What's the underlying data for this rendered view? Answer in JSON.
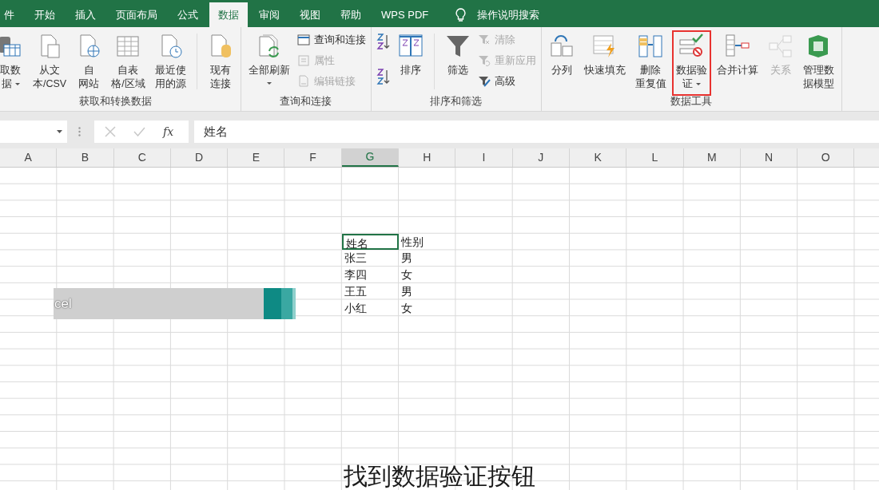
{
  "ribbon_tabs": [
    {
      "label": "件",
      "selected": false
    },
    {
      "label": "开始",
      "selected": false
    },
    {
      "label": "插入",
      "selected": false
    },
    {
      "label": "页面布局",
      "selected": false
    },
    {
      "label": "公式",
      "selected": false
    },
    {
      "label": "数据",
      "selected": true
    },
    {
      "label": "审阅",
      "selected": false
    },
    {
      "label": "视图",
      "selected": false
    },
    {
      "label": "帮助",
      "selected": false
    },
    {
      "label": "WPS PDF",
      "selected": false
    }
  ],
  "tell_me": "操作说明搜索",
  "ribbon_groups": [
    {
      "label": "获取和转换数据",
      "items": [
        {
          "kind": "large",
          "lines": [
            "取数",
            "据"
          ],
          "dropdown": true,
          "disabled": false,
          "highlighted": false
        },
        {
          "kind": "large",
          "lines": [
            "从文",
            "本/CSV"
          ],
          "dropdown": false,
          "disabled": false,
          "highlighted": false
        },
        {
          "kind": "large",
          "lines": [
            "自",
            "网站"
          ],
          "dropdown": false,
          "disabled": false,
          "highlighted": false
        },
        {
          "kind": "large",
          "lines": [
            "自表",
            "格/区域"
          ],
          "dropdown": false,
          "disabled": false,
          "highlighted": false
        },
        {
          "kind": "large",
          "lines": [
            "最近使",
            "用的源"
          ],
          "dropdown": false,
          "disabled": false,
          "highlighted": false
        },
        {
          "kind": "separator"
        },
        {
          "kind": "large",
          "lines": [
            "现有",
            "连接"
          ],
          "dropdown": false,
          "disabled": false,
          "highlighted": false
        }
      ]
    },
    {
      "label": "查询和连接",
      "items": [
        {
          "kind": "large",
          "lines": [
            "全部刷新"
          ],
          "dropdown": true,
          "disabled": false,
          "highlighted": false
        },
        {
          "kind": "stack",
          "items": [
            {
              "label": "查询和连接",
              "disabled": false
            },
            {
              "label": "属性",
              "disabled": true
            },
            {
              "label": "编辑链接",
              "disabled": true
            }
          ]
        }
      ]
    },
    {
      "label": "排序和筛选",
      "items": [
        {
          "kind": "stack",
          "items": [
            {
              "disabled": false
            },
            {
              "disabled": false
            }
          ]
        },
        {
          "kind": "large",
          "lines": [
            "排序"
          ],
          "dropdown": false,
          "disabled": false,
          "highlighted": false
        },
        {
          "kind": "separator"
        },
        {
          "kind": "large",
          "lines": [
            "筛选"
          ],
          "dropdown": false,
          "disabled": false,
          "highlighted": false
        },
        {
          "kind": "stack",
          "items": [
            {
              "label": "清除",
              "disabled": true
            },
            {
              "label": "重新应用",
              "disabled": true
            },
            {
              "label": "高级",
              "disabled": false
            }
          ]
        }
      ]
    },
    {
      "label": "数据工具",
      "items": [
        {
          "kind": "large",
          "lines": [
            "分列"
          ],
          "dropdown": false,
          "disabled": false,
          "highlighted": false
        },
        {
          "kind": "large",
          "lines": [
            "快速填充"
          ],
          "dropdown": false,
          "disabled": false,
          "highlighted": false
        },
        {
          "kind": "large",
          "lines": [
            "删除",
            "重复值"
          ],
          "dropdown": false,
          "disabled": false,
          "highlighted": false
        },
        {
          "kind": "large",
          "lines": [
            "数据验",
            "证"
          ],
          "dropdown": true,
          "disabled": false,
          "highlighted": true
        },
        {
          "kind": "large",
          "lines": [
            "合并计算"
          ],
          "dropdown": false,
          "disabled": false,
          "highlighted": false
        },
        {
          "kind": "large",
          "lines": [
            "关系"
          ],
          "dropdown": false,
          "disabled": true,
          "highlighted": false
        },
        {
          "kind": "large",
          "lines": [
            "管理数",
            "据模型"
          ],
          "dropdown": false,
          "disabled": false,
          "highlighted": false
        }
      ]
    }
  ],
  "formula_bar": {
    "function_label": "fx",
    "value": "姓名"
  },
  "sheet": {
    "columns": [
      {
        "label": "A",
        "selected": false
      },
      {
        "label": "B",
        "selected": false
      },
      {
        "label": "C",
        "selected": false
      },
      {
        "label": "D",
        "selected": false
      },
      {
        "label": "E",
        "selected": false
      },
      {
        "label": "F",
        "selected": false
      },
      {
        "label": "G",
        "selected": true
      },
      {
        "label": "H",
        "selected": false
      },
      {
        "label": "I",
        "selected": false
      },
      {
        "label": "J",
        "selected": false
      },
      {
        "label": "K",
        "selected": false
      },
      {
        "label": "L",
        "selected": false
      },
      {
        "label": "M",
        "selected": false
      },
      {
        "label": "N",
        "selected": false
      },
      {
        "label": "O",
        "selected": false
      }
    ],
    "rows": [
      [
        {
          "text": "姓名",
          "active": true
        },
        {
          "text": "性别",
          "active": false
        }
      ],
      [
        {
          "text": "张三",
          "active": false
        },
        {
          "text": "男",
          "active": false
        }
      ],
      [
        {
          "text": "李四",
          "active": false
        },
        {
          "text": "女",
          "active": false
        }
      ],
      [
        {
          "text": "王五",
          "active": false
        },
        {
          "text": "男",
          "active": false
        }
      ],
      [
        {
          "text": "小红",
          "active": false
        },
        {
          "text": "女",
          "active": false
        }
      ]
    ]
  },
  "lower_third": {
    "text": "cel"
  },
  "caption": "找到数据验证按钮"
}
